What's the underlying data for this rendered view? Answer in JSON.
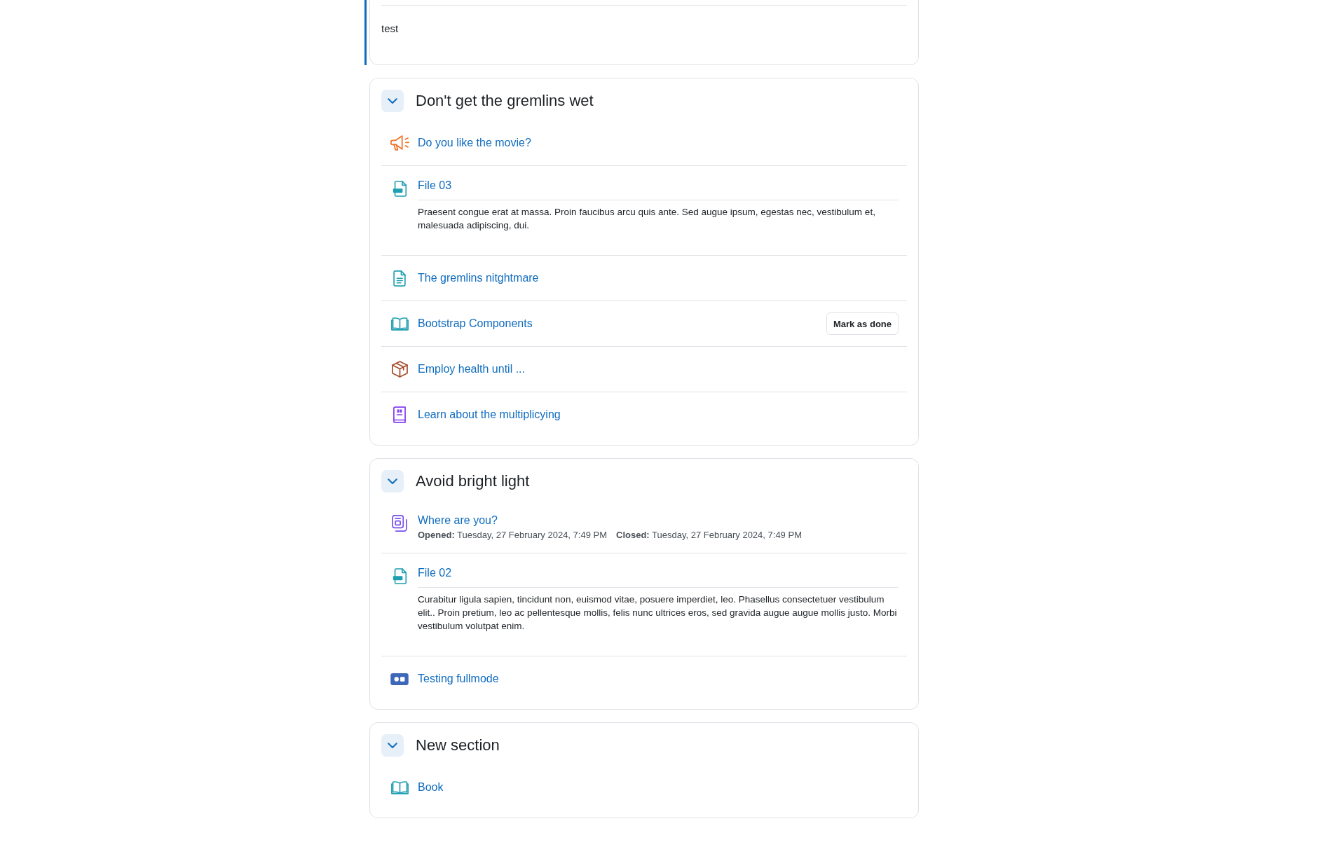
{
  "sections": [
    {
      "current": true,
      "summary": "test"
    },
    {
      "title": "Don't get the gremlins wet",
      "expanded": true,
      "current": false,
      "activities": [
        {
          "kind": "announcement",
          "name": "Do you like the movie?"
        },
        {
          "kind": "pdf",
          "name": "File 03",
          "description": "Praesent congue erat at massa. Proin faucibus arcu quis ante. Sed augue ipsum, egestas nec, vestibulum et, malesuada adipiscing, dui."
        },
        {
          "kind": "page",
          "name": "The gremlins nitghtmare"
        },
        {
          "kind": "book",
          "name": "Bootstrap Components",
          "completion_button": "Mark as done"
        },
        {
          "kind": "package",
          "name": "Employ health until ..."
        },
        {
          "kind": "glossary",
          "name": "Learn about the multiplicying"
        }
      ]
    },
    {
      "title": "Avoid bright light",
      "expanded": true,
      "current": false,
      "activities": [
        {
          "kind": "choice",
          "name": "Where are you?",
          "dates": [
            {
              "label": "Opened:",
              "value": "Tuesday, 27 February 2024, 7:49 PM"
            },
            {
              "label": "Closed:",
              "value": "Tuesday, 27 February 2024, 7:49 PM"
            }
          ]
        },
        {
          "kind": "pdf",
          "name": "File 02",
          "description": "Curabitur ligula sapien, tincidunt non, euismod vitae, posuere imperdiet, leo. Phasellus consectetuer vestibulum elit.. Proin pretium, leo ac pellentesque mollis, felis nunc ultrices eros, sed gravida augue augue mollis justo. Morbi vestibulum volutpat enim."
        },
        {
          "kind": "h5p",
          "name": "Testing fullmode"
        }
      ]
    },
    {
      "title": "New section",
      "expanded": true,
      "current": false,
      "activities": [
        {
          "kind": "book",
          "name": "Book"
        }
      ]
    }
  ]
}
